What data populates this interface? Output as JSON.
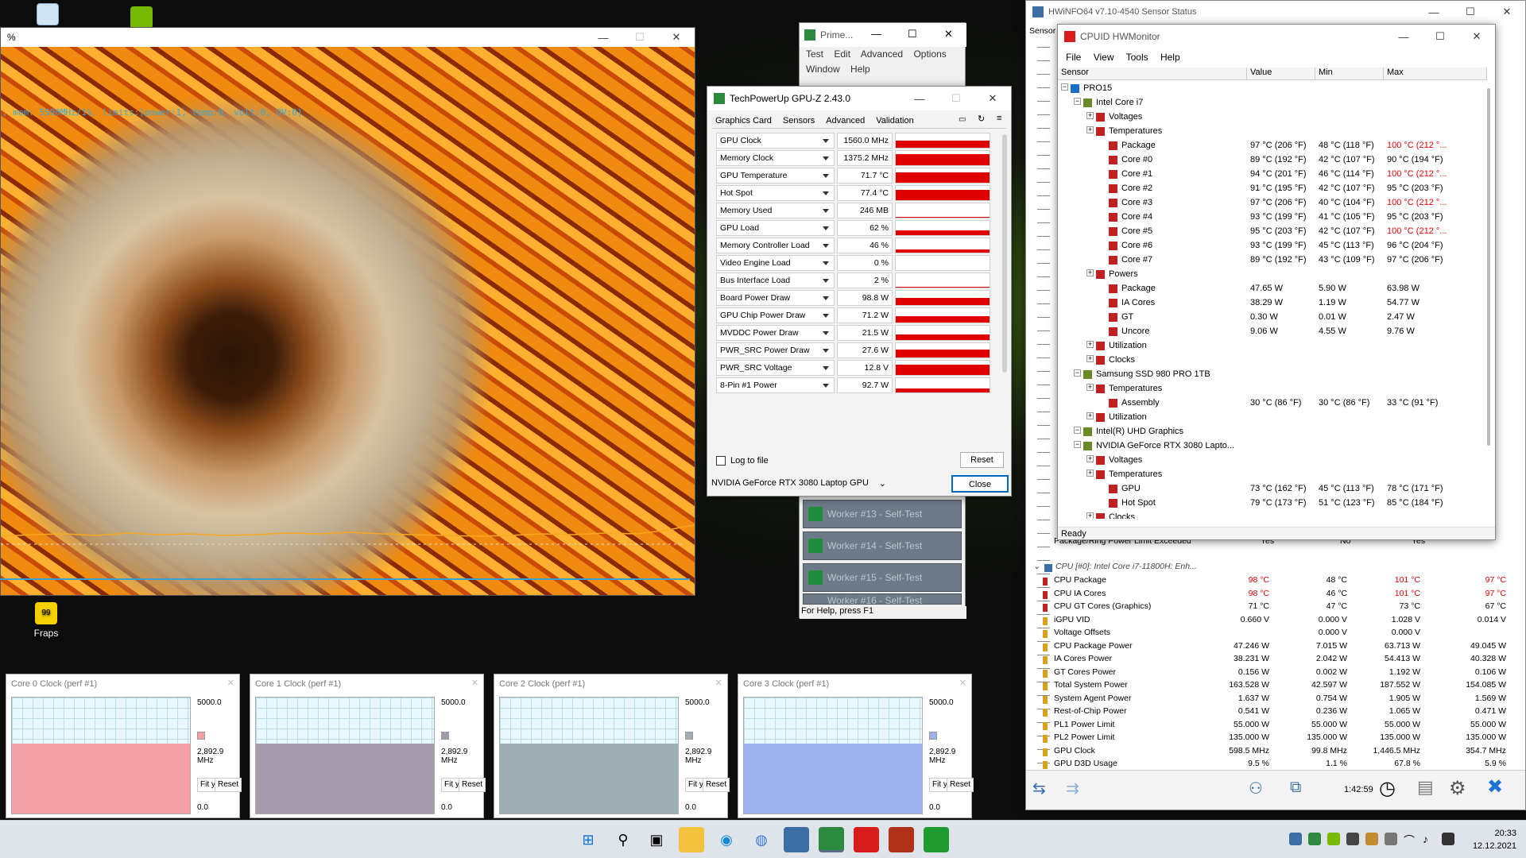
{
  "desktop": {
    "icons": [
      {
        "label": "",
        "name": "recycle-bin-icon"
      },
      {
        "label": "",
        "name": "nvidia-icon"
      },
      {
        "label": "Fraps",
        "name": "fraps-icon"
      }
    ]
  },
  "fractal": {
    "overlay_text": ", mem: 5500MHz/1%, limits:[power:1, temp:0, volt:0, OV:0]"
  },
  "prime": {
    "title": "Prime...",
    "menu": [
      "Test",
      "Edit",
      "Advanced",
      "Options",
      "Window",
      "Help"
    ],
    "workers": [
      "Worker #13 - Self-Test",
      "Worker #14 - Self-Test",
      "Worker #15 - Self-Test",
      "Worker #16 - Self-Test"
    ],
    "status": "For Help, press F1"
  },
  "gpuz": {
    "title": "TechPowerUp GPU-Z 2.43.0",
    "tabs": [
      "Graphics Card",
      "Sensors",
      "Advanced",
      "Validation"
    ],
    "sensors": [
      {
        "name": "GPU Clock",
        "value": "1560.0 MHz",
        "fill": 0.5
      },
      {
        "name": "Memory Clock",
        "value": "1375.2 MHz",
        "fill": 0.8
      },
      {
        "name": "GPU Temperature",
        "value": "71.7 °C",
        "fill": 0.7
      },
      {
        "name": "Hot Spot",
        "value": "77.4 °C",
        "fill": 0.75
      },
      {
        "name": "Memory Used",
        "value": "246 MB",
        "fill": 0.05
      },
      {
        "name": "GPU Load",
        "value": "62 %",
        "fill": 0.35
      },
      {
        "name": "Memory Controller Load",
        "value": "46 %",
        "fill": 0.25
      },
      {
        "name": "Video Engine Load",
        "value": "0 %",
        "fill": 0
      },
      {
        "name": "Bus Interface Load",
        "value": "2 %",
        "fill": 0.03
      },
      {
        "name": "Board Power Draw",
        "value": "98.8 W",
        "fill": 0.5
      },
      {
        "name": "GPU Chip Power Draw",
        "value": "71.2 W",
        "fill": 0.45
      },
      {
        "name": "MVDDC Power Draw",
        "value": "21.5 W",
        "fill": 0.4
      },
      {
        "name": "PWR_SRC Power Draw",
        "value": "27.6 W",
        "fill": 0.55
      },
      {
        "name": "PWR_SRC Voltage",
        "value": "12.8 V",
        "fill": 0.7
      },
      {
        "name": "8-Pin #1 Power",
        "value": "92.7 W",
        "fill": 0.3
      }
    ],
    "log_label": "Log to file",
    "reset": "Reset",
    "gpu_select": "NVIDIA GeForce RTX 3080 Laptop GPU",
    "close": "Close"
  },
  "hwinfo": {
    "title": "HWiNFO64 v7.10-4540 Sensor Status",
    "sensor_col": "Sensor",
    "partial_row": {
      "name": "Package/Ring Power Limit Exceeded",
      "cur": "Yes",
      "min": "No",
      "max": "Yes"
    },
    "group": "CPU [#0]: Intel Core i7-11800H: Enh...",
    "rows": [
      {
        "name": "CPU Package",
        "cur": "98 °C",
        "min": "48 °C",
        "max": "101 °C",
        "avg": "97 °C",
        "hot": true
      },
      {
        "name": "CPU IA Cores",
        "cur": "98 °C",
        "min": "46 °C",
        "max": "101 °C",
        "avg": "97 °C",
        "hot": true
      },
      {
        "name": "CPU GT Cores (Graphics)",
        "cur": "71 °C",
        "min": "47 °C",
        "max": "73 °C",
        "avg": "67 °C",
        "hot": false
      },
      {
        "name": "iGPU VID",
        "cur": "0.660 V",
        "min": "0.000 V",
        "max": "1.028 V",
        "avg": "0.014 V",
        "hot": false
      },
      {
        "name": "Voltage Offsets",
        "cur": "",
        "min": "0.000 V",
        "max": "0.000 V",
        "avg": "",
        "hot": false
      },
      {
        "name": "CPU Package Power",
        "cur": "47.246 W",
        "min": "7.015 W",
        "max": "63.713 W",
        "avg": "49.045 W",
        "hot": false
      },
      {
        "name": "IA Cores Power",
        "cur": "38.231 W",
        "min": "2.042 W",
        "max": "54.413 W",
        "avg": "40.328 W",
        "hot": false
      },
      {
        "name": "GT Cores Power",
        "cur": "0.156 W",
        "min": "0.002 W",
        "max": "1.192 W",
        "avg": "0.106 W",
        "hot": false
      },
      {
        "name": "Total System Power",
        "cur": "163.528 W",
        "min": "42.597 W",
        "max": "187.552 W",
        "avg": "154.085 W",
        "hot": false
      },
      {
        "name": "System Agent Power",
        "cur": "1.637 W",
        "min": "0.754 W",
        "max": "1.905 W",
        "avg": "1.569 W",
        "hot": false
      },
      {
        "name": "Rest-of-Chip Power",
        "cur": "0.541 W",
        "min": "0.236 W",
        "max": "1.065 W",
        "avg": "0.471 W",
        "hot": false
      },
      {
        "name": "PL1 Power Limit",
        "cur": "55.000 W",
        "min": "55.000 W",
        "max": "55.000 W",
        "avg": "55.000 W",
        "hot": false
      },
      {
        "name": "PL2 Power Limit",
        "cur": "135.000 W",
        "min": "135.000 W",
        "max": "135.000 W",
        "avg": "135.000 W",
        "hot": false
      },
      {
        "name": "GPU Clock",
        "cur": "598.5 MHz",
        "min": "99.8 MHz",
        "max": "1,446.5 MHz",
        "avg": "354.7 MHz",
        "hot": false
      },
      {
        "name": "GPU D3D Usage",
        "cur": "9.5 %",
        "min": "1.1 %",
        "max": "67.8 %",
        "avg": "5.9 %",
        "hot": false
      }
    ],
    "clock": "1:42:59"
  },
  "hwmon": {
    "title": "CPUID HWMonitor",
    "menu": [
      "File",
      "View",
      "Tools",
      "Help"
    ],
    "cols": [
      "Sensor",
      "Value",
      "Min",
      "Max"
    ],
    "rows": [
      {
        "indent": 0,
        "name": "PRO15",
        "value": "",
        "min": "",
        "max": "",
        "hot": false
      },
      {
        "indent": 1,
        "name": "Intel Core i7",
        "value": "",
        "min": "",
        "max": "",
        "hot": false
      },
      {
        "indent": 2,
        "name": "Voltages",
        "value": "",
        "min": "",
        "max": "",
        "hot": false
      },
      {
        "indent": 2,
        "name": "Temperatures",
        "value": "",
        "min": "",
        "max": "",
        "hot": false
      },
      {
        "indent": 3,
        "name": "Package",
        "value": "97 °C  (206 °F)",
        "min": "48 °C  (118 °F)",
        "max": "100 °C  (212 °...",
        "hot": true
      },
      {
        "indent": 3,
        "name": "Core #0",
        "value": "89 °C  (192 °F)",
        "min": "42 °C  (107 °F)",
        "max": "90 °C  (194 °F)",
        "hot": false
      },
      {
        "indent": 3,
        "name": "Core #1",
        "value": "94 °C  (201 °F)",
        "min": "46 °C  (114 °F)",
        "max": "100 °C  (212 °...",
        "hot": true
      },
      {
        "indent": 3,
        "name": "Core #2",
        "value": "91 °C  (195 °F)",
        "min": "42 °C  (107 °F)",
        "max": "95 °C  (203 °F)",
        "hot": false
      },
      {
        "indent": 3,
        "name": "Core #3",
        "value": "97 °C  (206 °F)",
        "min": "40 °C  (104 °F)",
        "max": "100 °C  (212 °...",
        "hot": true
      },
      {
        "indent": 3,
        "name": "Core #4",
        "value": "93 °C  (199 °F)",
        "min": "41 °C  (105 °F)",
        "max": "95 °C  (203 °F)",
        "hot": false
      },
      {
        "indent": 3,
        "name": "Core #5",
        "value": "95 °C  (203 °F)",
        "min": "42 °C  (107 °F)",
        "max": "100 °C  (212 °...",
        "hot": true
      },
      {
        "indent": 3,
        "name": "Core #6",
        "value": "93 °C  (199 °F)",
        "min": "45 °C  (113 °F)",
        "max": "96 °C  (204 °F)",
        "hot": false
      },
      {
        "indent": 3,
        "name": "Core #7",
        "value": "89 °C  (192 °F)",
        "min": "43 °C  (109 °F)",
        "max": "97 °C  (206 °F)",
        "hot": false
      },
      {
        "indent": 2,
        "name": "Powers",
        "value": "",
        "min": "",
        "max": "",
        "hot": false
      },
      {
        "indent": 3,
        "name": "Package",
        "value": "47.65 W",
        "min": "5.90 W",
        "max": "63.98 W",
        "hot": false
      },
      {
        "indent": 3,
        "name": "IA Cores",
        "value": "38.29 W",
        "min": "1.19 W",
        "max": "54.77 W",
        "hot": false
      },
      {
        "indent": 3,
        "name": "GT",
        "value": "0.30 W",
        "min": "0.01 W",
        "max": "2.47 W",
        "hot": false
      },
      {
        "indent": 3,
        "name": "Uncore",
        "value": "9.06 W",
        "min": "4.55 W",
        "max": "9.76 W",
        "hot": false
      },
      {
        "indent": 2,
        "name": "Utilization",
        "value": "",
        "min": "",
        "max": "",
        "hot": false
      },
      {
        "indent": 2,
        "name": "Clocks",
        "value": "",
        "min": "",
        "max": "",
        "hot": false
      },
      {
        "indent": 1,
        "name": "Samsung SSD 980 PRO 1TB",
        "value": "",
        "min": "",
        "max": "",
        "hot": false
      },
      {
        "indent": 2,
        "name": "Temperatures",
        "value": "",
        "min": "",
        "max": "",
        "hot": false
      },
      {
        "indent": 3,
        "name": "Assembly",
        "value": "30 °C  (86 °F)",
        "min": "30 °C  (86 °F)",
        "max": "33 °C  (91 °F)",
        "hot": false
      },
      {
        "indent": 2,
        "name": "Utilization",
        "value": "",
        "min": "",
        "max": "",
        "hot": false
      },
      {
        "indent": 1,
        "name": "Intel(R) UHD Graphics",
        "value": "",
        "min": "",
        "max": "",
        "hot": false
      },
      {
        "indent": 1,
        "name": "NVIDIA GeForce RTX 3080 Lapto...",
        "value": "",
        "min": "",
        "max": "",
        "hot": false
      },
      {
        "indent": 2,
        "name": "Voltages",
        "value": "",
        "min": "",
        "max": "",
        "hot": false
      },
      {
        "indent": 2,
        "name": "Temperatures",
        "value": "",
        "min": "",
        "max": "",
        "hot": false
      },
      {
        "indent": 3,
        "name": "GPU",
        "value": "73 °C  (162 °F)",
        "min": "45 °C  (113 °F)",
        "max": "78 °C  (171 °F)",
        "hot": false
      },
      {
        "indent": 3,
        "name": "Hot Spot",
        "value": "79 °C  (173 °F)",
        "min": "51 °C  (123 °F)",
        "max": "85 °C  (184 °F)",
        "hot": false
      },
      {
        "indent": 2,
        "name": "Clocks",
        "value": "",
        "min": "",
        "max": "",
        "hot": false
      }
    ],
    "status": "Ready"
  },
  "perf": [
    {
      "title": "Core 0 Clock (perf #1)",
      "max": "5000.0",
      "cur": "2,892.9 MHz",
      "min": "0.0",
      "color": "#f4a0a4"
    },
    {
      "title": "Core 1 Clock (perf #1)",
      "max": "5000.0",
      "cur": "2,892.9 MHz",
      "min": "0.0",
      "color": "#a59aae"
    },
    {
      "title": "Core 2 Clock (perf #1)",
      "max": "5000.0",
      "cur": "2,892.9 MHz",
      "min": "0.0",
      "color": "#9eaeb2"
    },
    {
      "title": "Core 3 Clock (perf #1)",
      "max": "5000.0",
      "cur": "2,892.9 MHz",
      "min": "0.0",
      "color": "#9fb2f0"
    }
  ],
  "perf_buttons": {
    "fit": "Fit y",
    "reset": "Reset"
  },
  "taskbar": {
    "time": "20:33",
    "date": "12.12.2021"
  }
}
